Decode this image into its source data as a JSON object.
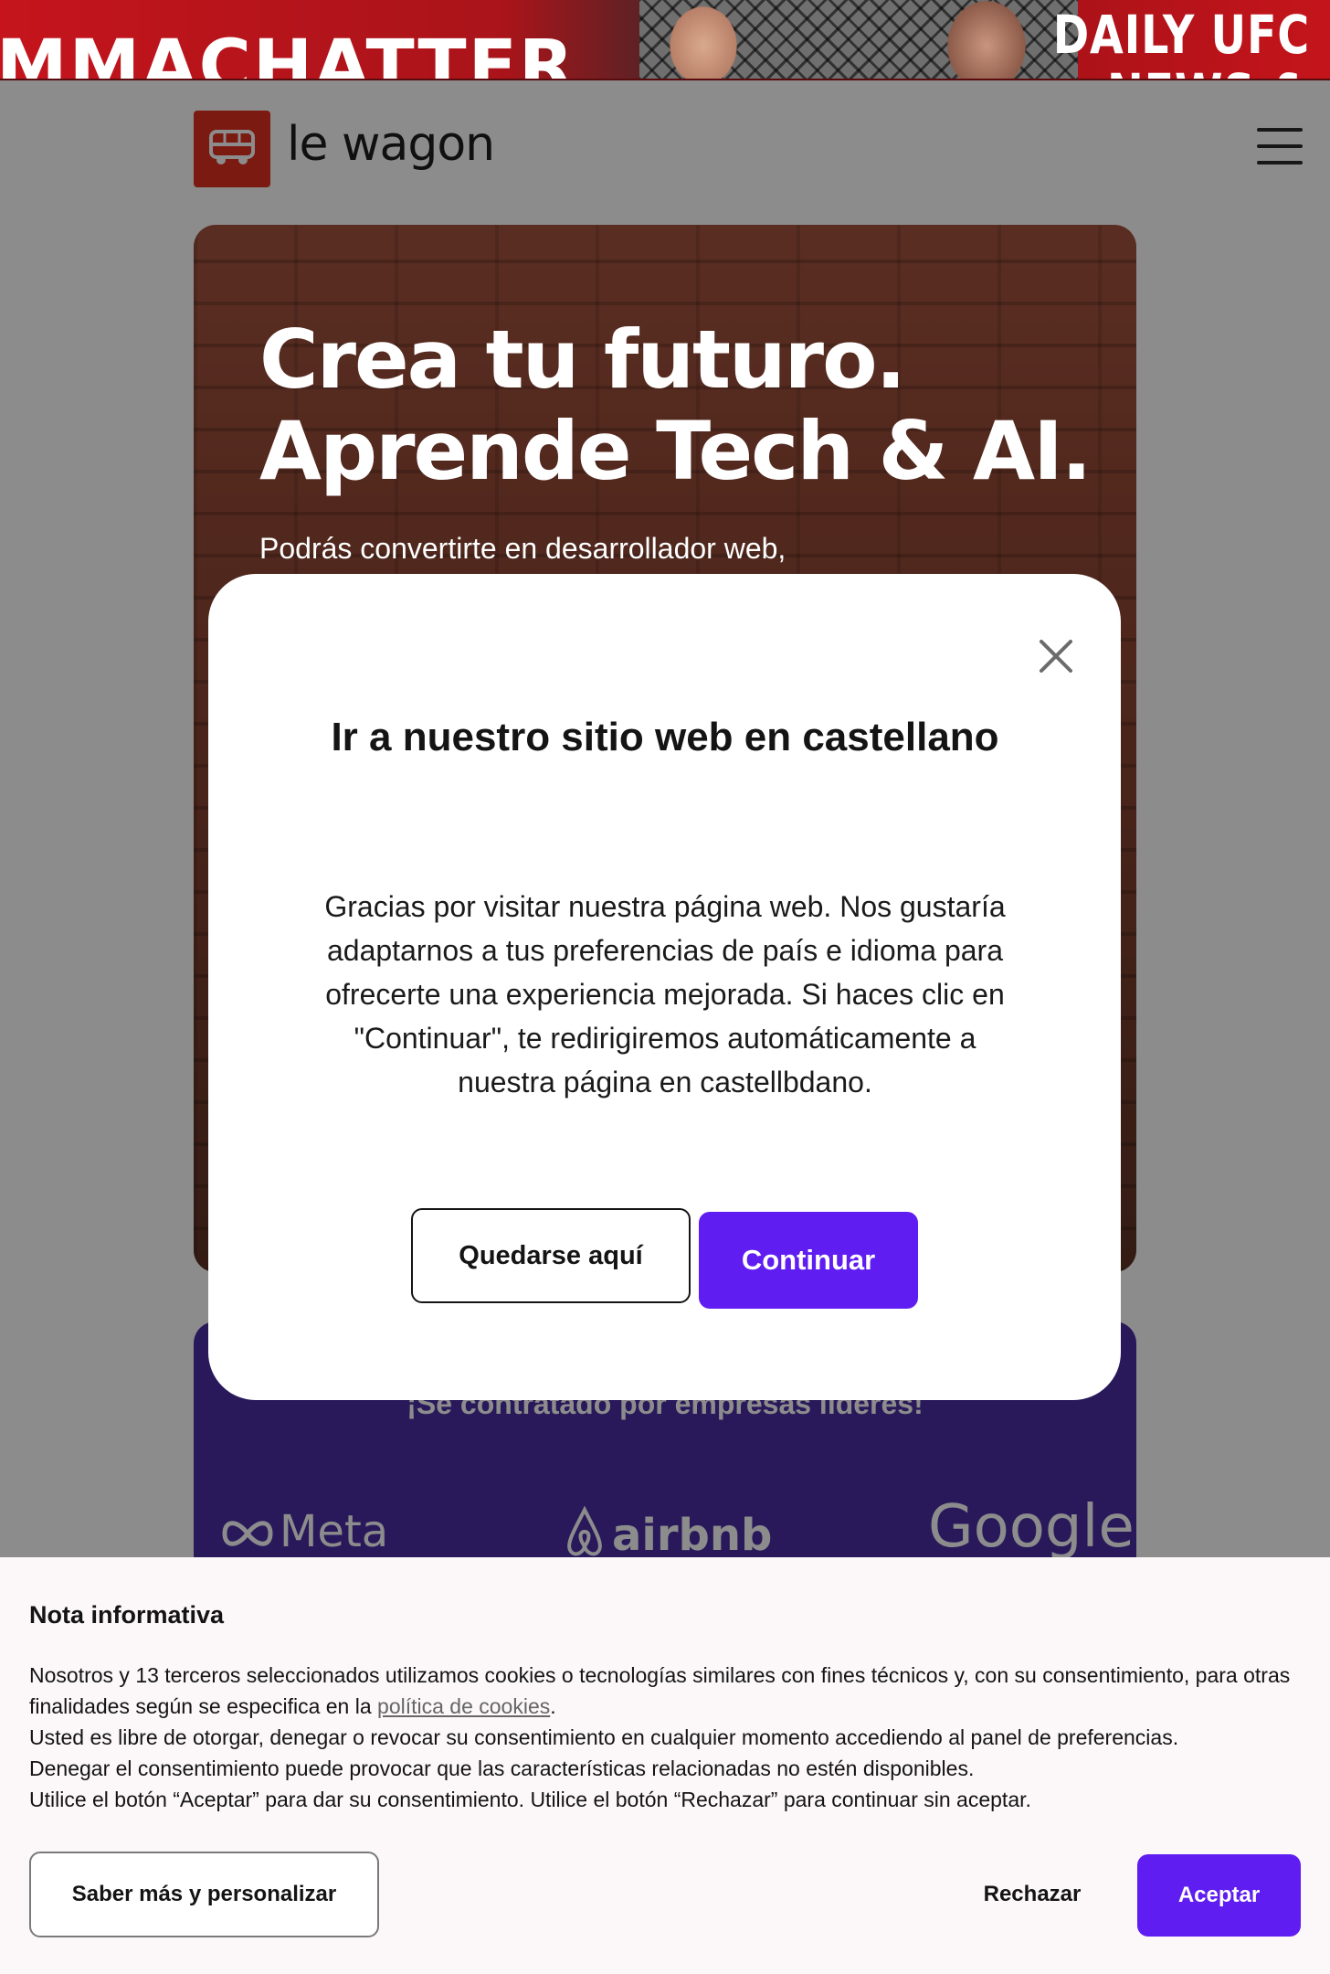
{
  "ad": {
    "left_text": "MMACHATTER",
    "right_line1": "DAILY UFC",
    "right_line2": "NEWS &"
  },
  "header": {
    "logo_text": "le wagon"
  },
  "hero": {
    "title_line1": "Crea tu futuro.",
    "title_line2": "Aprende Tech & AI.",
    "subtitle": "Podrás convertirte en desarrollador web,"
  },
  "logos": {
    "heading": "¡Sé contratado por empresas líderes!",
    "companies": [
      "Meta",
      "airbnb",
      "Google"
    ]
  },
  "modal": {
    "title": "Ir a nuestro sitio web en castellano",
    "body": "Gracias por visitar nuestra página web. Nos gustaría adaptarnos a tus preferencias de país e idioma para ofrecerte una experiencia mejorada. Si haces clic en \"Continuar\", te redirigiremos automáticamente a nuestra página en castellbdano.",
    "stay_label": "Quedarse aquí",
    "continue_label": "Continuar"
  },
  "cookie": {
    "title": "Nota informativa",
    "text_part1": "Nosotros y 13 terceros seleccionados utilizamos cookies o tecnologías similares con fines técnicos y, con su consentimiento, para otras finalidades según se especifica en la ",
    "link_text": "política de cookies",
    "text_part2": ".",
    "line2": "Usted es libre de otorgar, denegar o revocar su consentimiento en cualquier momento accediendo al panel de preferencias.",
    "line3": "Denegar el consentimiento puede provocar que las características relacionadas no estén disponibles.",
    "line4": "Utilice el botón “Aceptar” para dar su consentimiento. Utilice el botón “Rechazar” para continuar sin aceptar.",
    "more_label": "Saber más y personalizar",
    "reject_label": "Rechazar",
    "accept_label": "Aceptar"
  },
  "colors": {
    "brand_red": "#e1301f",
    "accent_purple": "#5f1df2",
    "logos_bg": "#4b2ea7"
  }
}
